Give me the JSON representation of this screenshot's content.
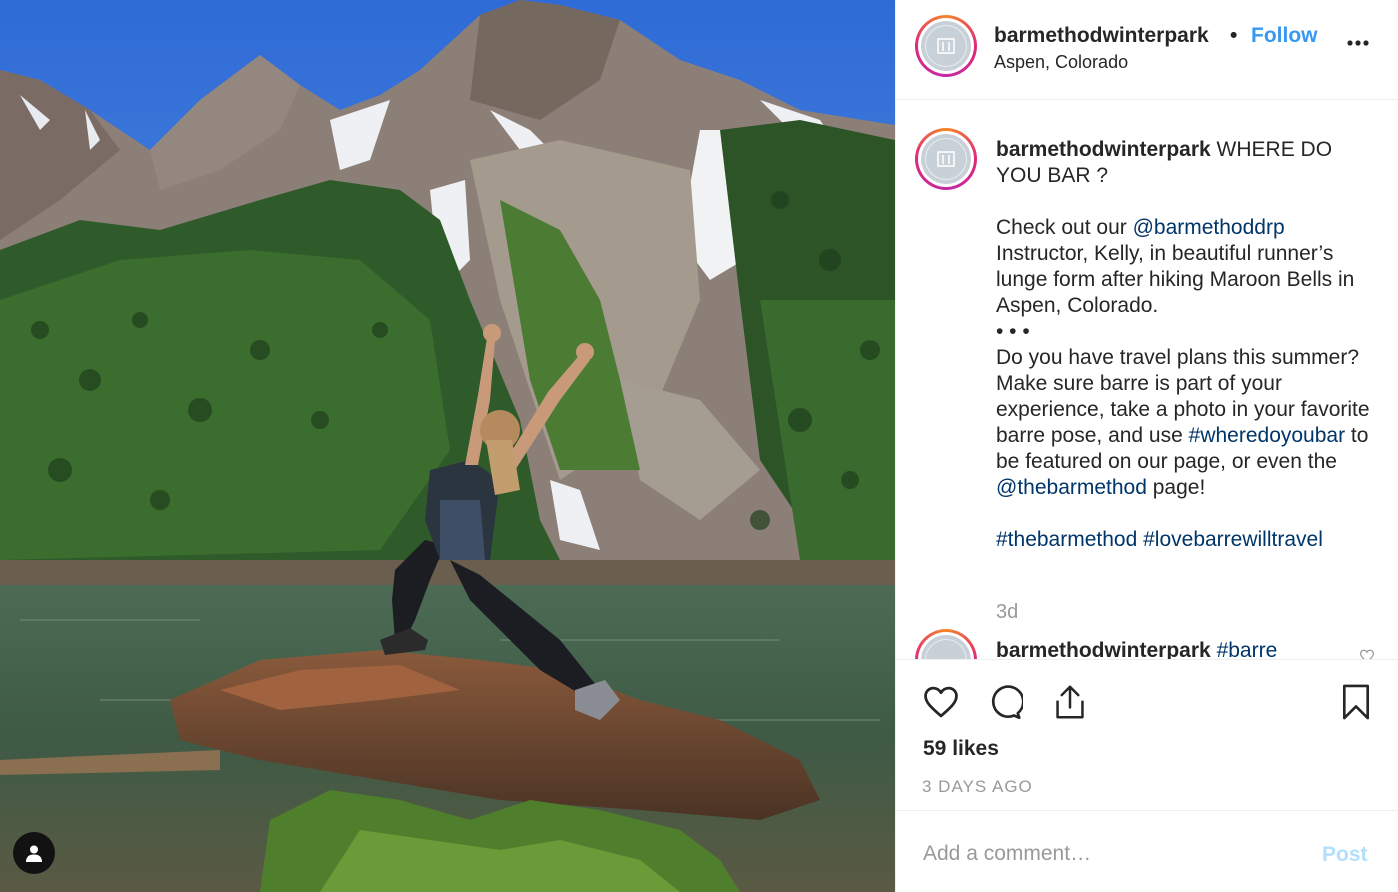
{
  "post": {
    "username": "barmethodwinterpark",
    "dot": "•",
    "follow_label": "Follow",
    "location": "Aspen, Colorado",
    "more_icon": "more-horizontal-icon"
  },
  "caption": {
    "username": "barmethodwinterpark",
    "line1": " WHERE DO YOU BAR ?",
    "p2_a": "Check out our ",
    "mention1": "@barmethoddrp",
    "p2_b": " Instructor, Kelly, in beautiful runner’s lunge form after hiking Maroon Bells in Aspen, Colorado.",
    "dots": "• • •",
    "p3_a": "Do you have travel plans this summer? Make sure barre is part of your experience, take a photo in your favorite barre pose, and use ",
    "hashtag1": "#wheredoyoubar",
    "p3_b": " to be featured on our page, or even the ",
    "mention2": "@thebarmethod",
    "p3_c": " page!",
    "hashtag2": "#thebarmethod",
    "hashtag3": "#lovebarrewilltravel",
    "time": "3d"
  },
  "next_comment": {
    "username": "barmethodwinterpark",
    "text": "#barre"
  },
  "actions": {
    "likes": "59 likes",
    "date": "3 DAYS AGO"
  },
  "comment_box": {
    "placeholder": "Add a comment…",
    "post_label": "Post"
  },
  "colors": {
    "link": "#003569",
    "follow": "#3897f0",
    "muted": "#999999",
    "post_disabled": "#b2dffc"
  }
}
